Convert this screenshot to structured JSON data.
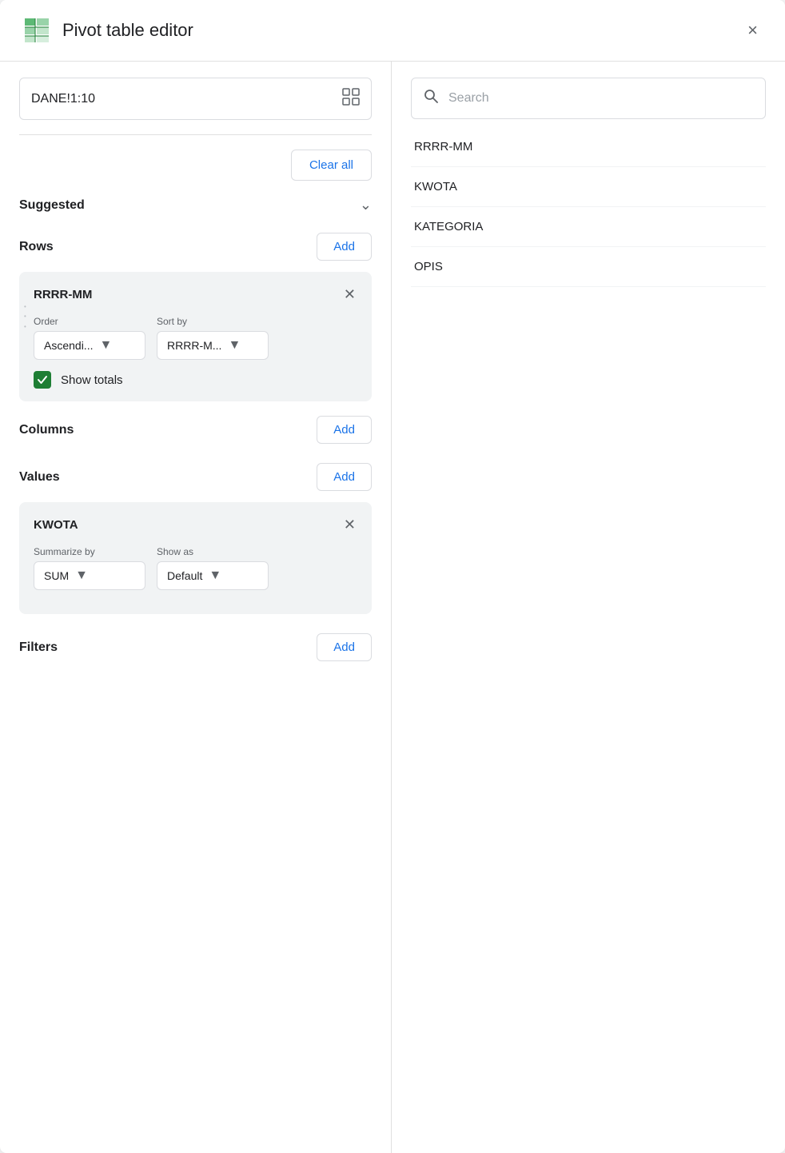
{
  "header": {
    "title": "Pivot table editor",
    "close_label": "×"
  },
  "left_panel": {
    "data_range": {
      "value": "DANE!1:10",
      "grid_icon": "⊞"
    },
    "clear_all_label": "Clear all",
    "suggested": {
      "label": "Suggested"
    },
    "rows": {
      "label": "Rows",
      "add_label": "Add",
      "field_card": {
        "title": "RRRR-MM",
        "order_label": "Order",
        "order_value": "Ascendi...",
        "sort_by_label": "Sort by",
        "sort_by_value": "RRRR-M...",
        "show_totals_label": "Show totals",
        "show_totals_checked": true
      }
    },
    "columns": {
      "label": "Columns",
      "add_label": "Add"
    },
    "values": {
      "label": "Values",
      "add_label": "Add",
      "field_card": {
        "title": "KWOTA",
        "summarize_by_label": "Summarize by",
        "summarize_by_value": "SUM",
        "show_as_label": "Show as",
        "show_as_value": "Default"
      }
    },
    "filters": {
      "label": "Filters",
      "add_label": "Add"
    }
  },
  "right_panel": {
    "search": {
      "placeholder": "Search"
    },
    "fields": [
      {
        "name": "RRRR-MM"
      },
      {
        "name": "KWOTA"
      },
      {
        "name": "KATEGORIA"
      },
      {
        "name": "OPIS"
      }
    ]
  }
}
